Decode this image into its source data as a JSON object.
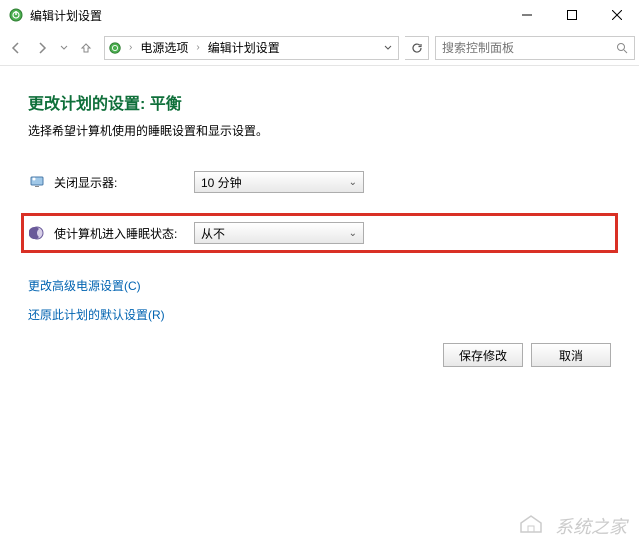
{
  "window": {
    "title": "编辑计划设置"
  },
  "breadcrumb": {
    "items": [
      "电源选项",
      "编辑计划设置"
    ]
  },
  "search": {
    "placeholder": "搜索控制面板"
  },
  "page": {
    "title": "更改计划的设置: 平衡",
    "subtitle": "选择希望计算机使用的睡眠设置和显示设置。"
  },
  "settings": {
    "display": {
      "label": "关闭显示器:",
      "value": "10 分钟"
    },
    "sleep": {
      "label": "使计算机进入睡眠状态:",
      "value": "从不"
    }
  },
  "links": {
    "advanced": "更改高级电源设置(C)",
    "restore": "还原此计划的默认设置(R)"
  },
  "buttons": {
    "save": "保存修改",
    "cancel": "取消"
  },
  "watermark": "系统之家"
}
